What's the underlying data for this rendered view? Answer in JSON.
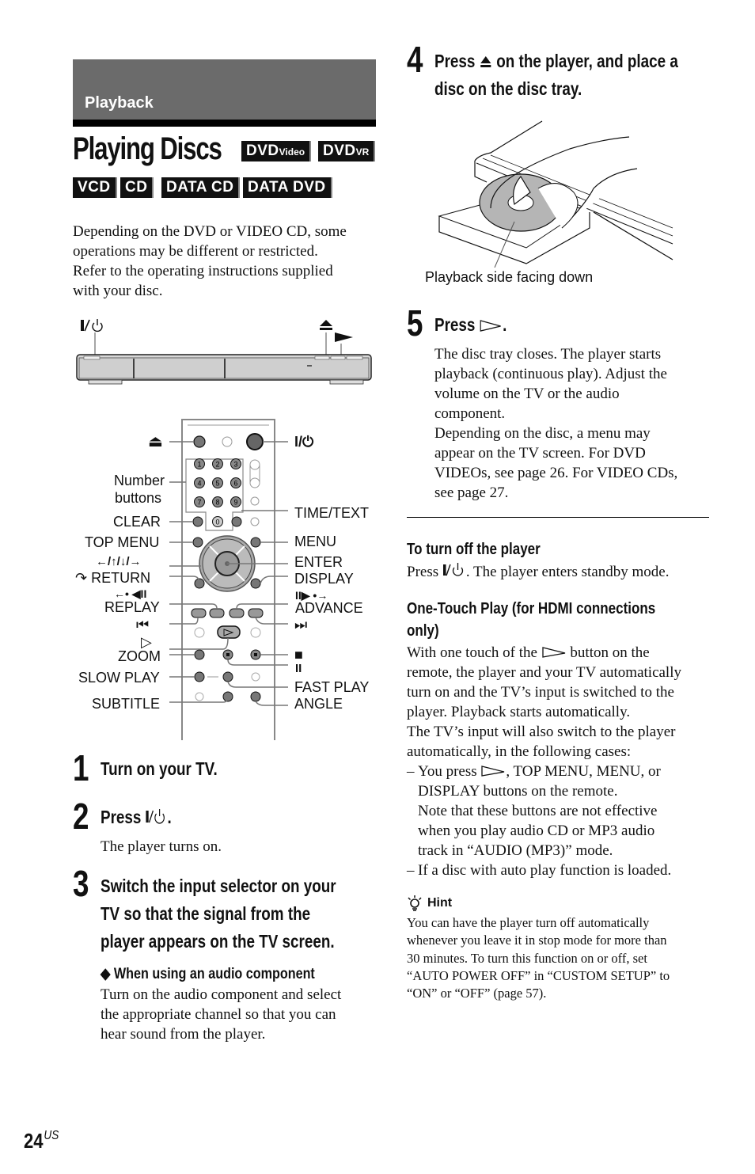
{
  "section": {
    "label": "Playback"
  },
  "title": "Playing Discs",
  "disc_badges": [
    {
      "main": "DVD",
      "sub": "Video"
    },
    {
      "main": "DVD",
      "sub": "VR"
    },
    {
      "main": "VCD",
      "sub": ""
    },
    {
      "main": "CD",
      "sub": ""
    },
    {
      "main": "DATA CD",
      "sub": ""
    },
    {
      "main": "DATA DVD",
      "sub": ""
    }
  ],
  "intro": {
    "lines": [
      "Depending on the DVD or VIDEO CD, some",
      "operations may be different or restricted.",
      "Refer to the operating instructions supplied",
      "with your disc."
    ]
  },
  "player_diagram": {
    "labels": {
      "power": "I/⏻",
      "eject": "⏏",
      "play": "▶"
    }
  },
  "remote_diagram": {
    "left_labels": {
      "eject": "⏏",
      "number_1": "Number",
      "number_2": "buttons",
      "clear": "CLEAR",
      "top_menu": "TOP MENU",
      "arrows": "←/↑/↓/→",
      "return": "RETURN",
      "replay_sym": "←• ◀II",
      "replay": "REPLAY",
      "prev": "⏮",
      "play": "▷",
      "zoom": "ZOOM",
      "slow_play": "SLOW PLAY",
      "subtitle": "SUBTITLE"
    },
    "right_labels": {
      "power": "I/⏻",
      "time_text": "TIME/TEXT",
      "menu": "MENU",
      "enter": "ENTER",
      "display": "DISPLAY",
      "advance_sym": "II▶ •→",
      "advance": "ADVANCE",
      "next": "⏭",
      "stop": "■",
      "pause": "II",
      "fast_play": "FAST PLAY",
      "angle": "ANGLE"
    },
    "number_keys": [
      "1",
      "2",
      "3",
      "4",
      "5",
      "6",
      "7",
      "8",
      "9",
      "0"
    ]
  },
  "steps": [
    {
      "num": "1",
      "title": "Turn on your TV."
    },
    {
      "num": "2",
      "title_prefix": "Press ",
      "title_suffix": ".",
      "body": "The player turns on."
    },
    {
      "num": "3",
      "title_lines": [
        "Switch the input selector on your",
        "TV so that the signal from the",
        "player appears on the TV screen."
      ],
      "sub_heading": "◆ When using an audio component",
      "body_lines": [
        "Turn on the audio component and select",
        "the appropriate channel so that you can",
        "hear sound from the player."
      ]
    },
    {
      "num": "4",
      "title_line1_prefix": "Press ",
      "title_line1_suffix": " on the player, and place a",
      "title_line2": "disc on the disc tray.",
      "caption": "Playback side facing down"
    },
    {
      "num": "5",
      "title_prefix": "Press ",
      "title_suffix": ".",
      "body_lines": [
        "The disc tray closes. The player starts",
        "playback (continuous play). Adjust the",
        "volume on the TV or the audio",
        "component.",
        "Depending on the disc, a menu may",
        "appear on the TV screen. For DVD",
        "VIDEOs, see page 26. For VIDEO CDs,",
        "see page 27."
      ]
    }
  ],
  "turn_off": {
    "heading": "To turn off the player",
    "body_prefix": "Press ",
    "body_suffix": ". The player enters standby mode."
  },
  "one_touch": {
    "heading_line1": "One-Touch Play (for HDMI connections",
    "heading_line2": "only)",
    "line1_prefix": "With one touch of the ",
    "line1_suffix": " button on the",
    "lines": [
      "remote, the player and your TV automatically",
      "turn on and the TV’s input is switched to the",
      "player. Playback starts automatically.",
      "The TV’s input will also switch to the player",
      "automatically, in the following cases:"
    ],
    "cases": [
      {
        "dash": "–",
        "first_prefix": "You press ",
        "first_suffix": ", TOP MENU, MENU, or",
        "rest": [
          "DISPLAY buttons on the remote.",
          "Note that these buttons are not effective",
          "when you play audio CD or MP3 audio",
          "track in “AUDIO (MP3)” mode."
        ]
      },
      {
        "dash": "–",
        "first": "If a disc with auto play function is loaded."
      }
    ]
  },
  "hint": {
    "heading": "Hint",
    "lines": [
      "You can have the player turn off automatically",
      "whenever you leave it in stop mode for more than",
      "30 minutes. To turn this function on or off, set",
      "“AUTO POWER OFF” in “CUSTOM SETUP” to",
      "“ON” or “OFF” (page 57)."
    ]
  },
  "page_number": {
    "num": "24",
    "suffix": "US"
  },
  "colors": {
    "section_band": "#6b6b6b",
    "badge": "#111111",
    "disc": "#b5b5b5"
  }
}
